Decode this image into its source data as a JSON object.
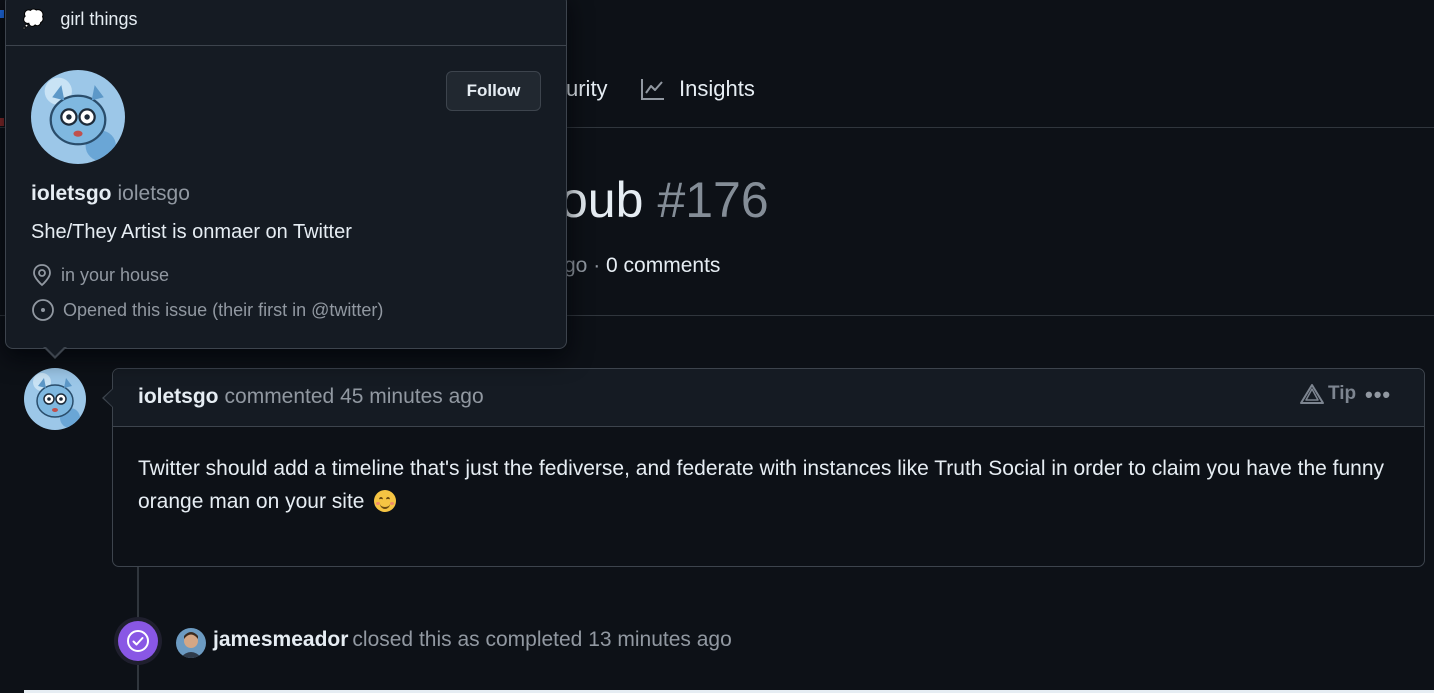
{
  "tabs": {
    "partial_label": "urity",
    "insights_label": "Insights"
  },
  "issue": {
    "title_visible": "oub",
    "number": "#176",
    "meta_partial": "go · ",
    "comments": "0 comments"
  },
  "comment": {
    "author": "ioletsgo",
    "action": "commented 45 minutes ago",
    "tip_label": "Tip",
    "more_label": "•••",
    "body": "Twitter should add a timeline that's just the fediverse, and federate with instances like Truth Social in order to claim you have the funny orange man on your site"
  },
  "closed_event": {
    "user": "jamesmeador",
    "text": "closed this as completed 13 minutes ago"
  },
  "hovercard": {
    "status_icon": "💭",
    "status_text": "girl things",
    "follow_label": "Follow",
    "name": "ioletsgo",
    "login": "ioletsgo",
    "bio": "She/They Artist is onmaer on Twitter",
    "location": "in your house",
    "opened_note": "Opened this issue (their first in @twitter)"
  },
  "colors": {
    "background": "#0d1117",
    "header_bg": "#151b23",
    "border": "#3d444d",
    "muted_text": "#9198a1",
    "closed_purple": "#8957e5"
  }
}
